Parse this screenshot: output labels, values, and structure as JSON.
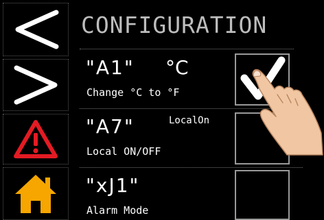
{
  "sidebar": {
    "items": [
      {
        "name": "previous",
        "icon": "chevron-left-icon"
      },
      {
        "name": "next",
        "icon": "chevron-right-icon"
      },
      {
        "name": "alarm",
        "icon": "warning-triangle-icon"
      },
      {
        "name": "home",
        "icon": "home-icon"
      }
    ]
  },
  "header": {
    "title": "CONFIGURATION"
  },
  "rows": [
    {
      "param": "\"A1\"",
      "unit": "°C",
      "badge": "",
      "desc": "Change °C to °F",
      "checked": true
    },
    {
      "param": "\"A7\"",
      "unit": "",
      "badge": "LocalOn",
      "desc": "Local ON/OFF",
      "checked": false
    },
    {
      "param": "\"xJ1\"",
      "unit": "",
      "badge": "",
      "desc": "Alarm Mode",
      "checked": false
    }
  ],
  "colors": {
    "background": "#000000",
    "title": "#bdbdbd",
    "alarm": "#e31b23",
    "home": "#f7a600",
    "icon": "#ffffff"
  }
}
